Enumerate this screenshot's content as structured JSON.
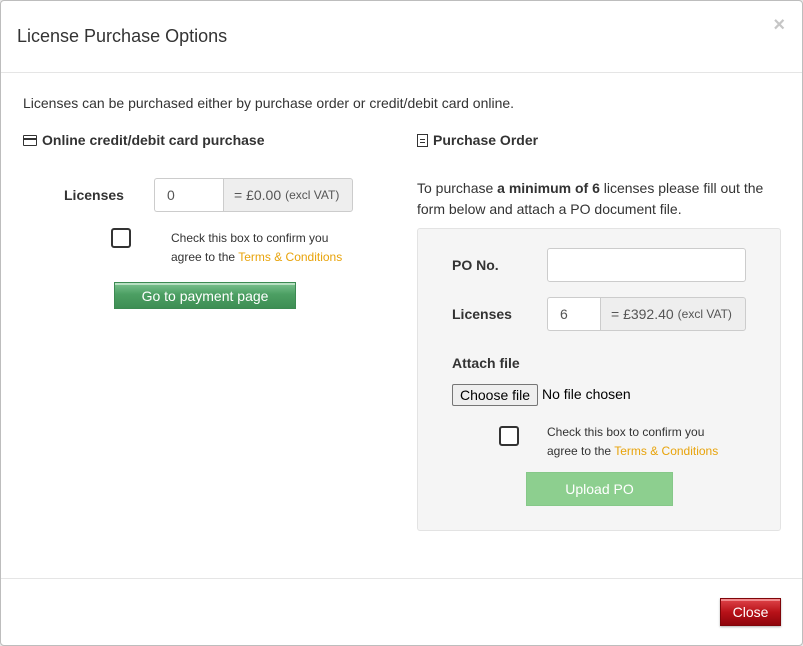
{
  "modal": {
    "title": "License Purchase Options",
    "close_symbol": "×",
    "intro": "Licenses can be purchased either by purchase order or credit/debit card online."
  },
  "online": {
    "title": "Online credit/debit card purchase",
    "icon": "credit-card-icon",
    "licenses_label": "Licenses",
    "licenses_value": "0",
    "price": "= £0.00",
    "price_note": "(excl VAT)",
    "checkbox_text": "Check this box to confirm you agree to the",
    "terms_link": "Terms & Conditions",
    "checked": false,
    "pay_button": "Go to payment page"
  },
  "po": {
    "title": "Purchase Order",
    "icon": "document-icon",
    "intro_before": "To purchase ",
    "intro_bold": "a minimum of 6",
    "intro_after": " licenses please fill out the form below and attach a PO document file.",
    "po_label": "PO No.",
    "po_value": "",
    "licenses_label": "Licenses",
    "licenses_value": "6",
    "price": "= £392.40",
    "price_note": "(excl VAT)",
    "attach_label": "Attach file",
    "choose_file": "Choose file",
    "file_status": "No file chosen",
    "checkbox_text": "Check this box to confirm you agree to the",
    "terms_link": "Terms & Conditions",
    "checked": false,
    "upload_button": "Upload PO"
  },
  "footer": {
    "close_button": "Close"
  },
  "colors": {
    "link": "#e8a30a",
    "pay_green": "#4c9f63",
    "upload_green": "#8dcf8f",
    "close_red": "#b81219"
  }
}
